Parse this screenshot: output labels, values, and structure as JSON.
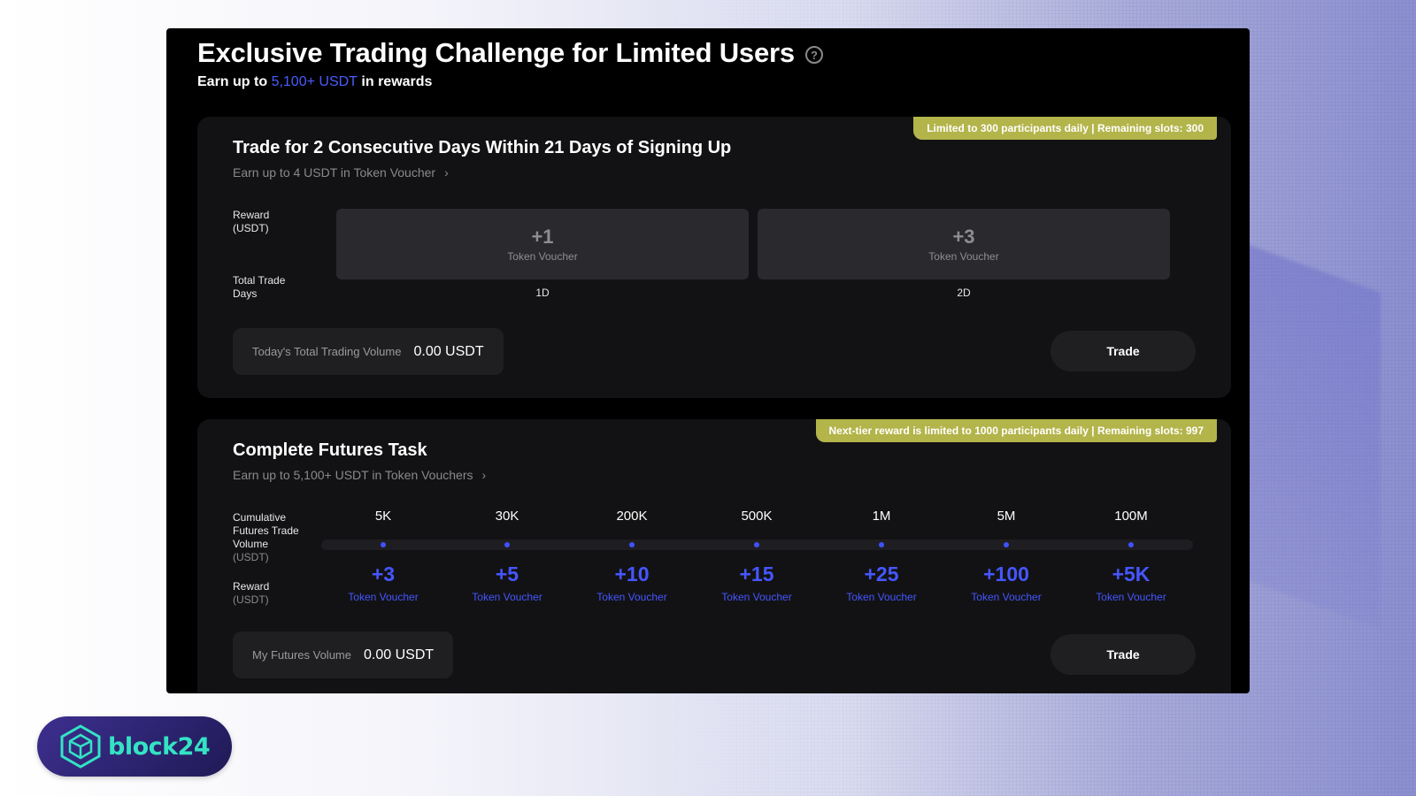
{
  "header": {
    "title": "Exclusive Trading Challenge for Limited Users",
    "subtitle_prefix": "Earn up to ",
    "subtitle_accent": "5,100+ USDT",
    "subtitle_suffix": " in rewards",
    "help_glyph": "?"
  },
  "card1": {
    "badge": "Limited to 300 participants daily | Remaining slots: 300",
    "title": "Trade for 2 Consecutive Days Within 21 Days of Signing Up",
    "subtitle": "Earn up to 4 USDT in Token Voucher",
    "reward_label_1": "Reward",
    "reward_label_2": "(USDT)",
    "days_label_1": "Total Trade",
    "days_label_2": "Days",
    "rewards": [
      {
        "amount": "+1",
        "label": "Token Voucher",
        "day": "1D"
      },
      {
        "amount": "+3",
        "label": "Token Voucher",
        "day": "2D"
      }
    ],
    "volume_label": "Today's Total Trading Volume",
    "volume_value": "0.00 USDT",
    "trade_button": "Trade"
  },
  "card2": {
    "badge": "Next-tier reward is limited to 1000 participants daily | Remaining slots: 997",
    "title": "Complete Futures Task",
    "subtitle": "Earn up to 5,100+ USDT in Token Vouchers",
    "vol_label_1": "Cumulative",
    "vol_label_2": "Futures Trade",
    "vol_label_3": "Volume",
    "vol_label_4": "(USDT)",
    "reward_label_1": "Reward",
    "reward_label_2": "(USDT)",
    "tiers": [
      {
        "volume": "5K",
        "reward": "+3",
        "label": "Token Voucher"
      },
      {
        "volume": "30K",
        "reward": "+5",
        "label": "Token Voucher"
      },
      {
        "volume": "200K",
        "reward": "+10",
        "label": "Token Voucher"
      },
      {
        "volume": "500K",
        "reward": "+15",
        "label": "Token Voucher"
      },
      {
        "volume": "1M",
        "reward": "+25",
        "label": "Token Voucher"
      },
      {
        "volume": "5M",
        "reward": "+100",
        "label": "Token Voucher"
      },
      {
        "volume": "100M",
        "reward": "+5K",
        "label": "Token Voucher"
      }
    ],
    "volume_label": "My Futures Volume",
    "volume_value": "0.00 USDT",
    "trade_button": "Trade"
  },
  "logo": {
    "text": "block24",
    "icon": "cube-logo-icon"
  },
  "colors": {
    "accent": "#4556ff",
    "badge": "#b3b44a",
    "panel": "#000000",
    "card": "#121214",
    "logo_text": "#34e3c4"
  }
}
